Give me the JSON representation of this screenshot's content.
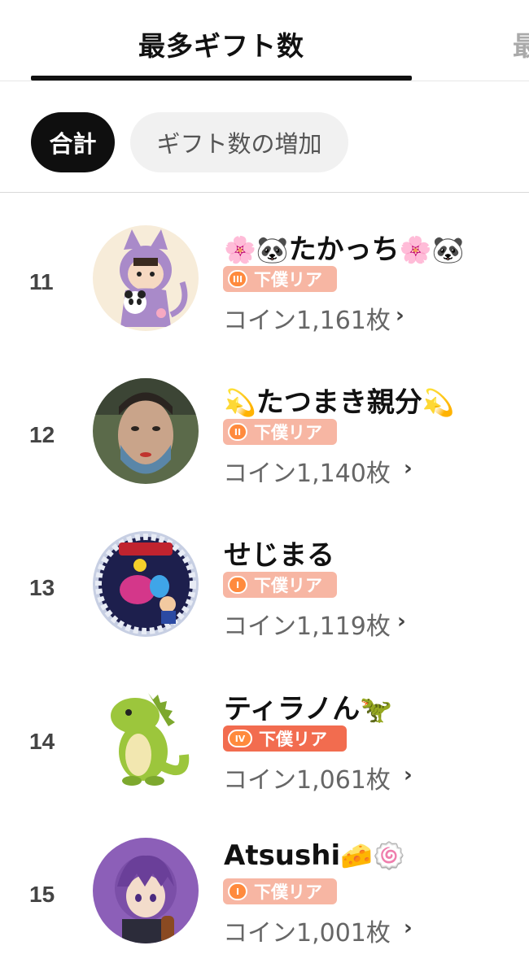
{
  "tabs": {
    "active": "最多ギフト数",
    "next_partial": "最"
  },
  "filters": {
    "total": "合計",
    "increase": "ギフト数の増加"
  },
  "badge_label": "下僕リア",
  "rows": [
    {
      "rank": "11",
      "name": "たかっち",
      "name_pre": "🌸🐼",
      "name_post": "🌸🐼",
      "badge_level": "III",
      "coins": "コイン1,161枚",
      "avatar": "cat-costume-panda-icon"
    },
    {
      "rank": "12",
      "name": "たつまき親分",
      "name_pre": "💫",
      "name_post": "💫",
      "badge_level": "II",
      "coins": "コイン1,140枚",
      "avatar": "face-photo-icon"
    },
    {
      "rank": "13",
      "name": "せじまる",
      "name_pre": "",
      "name_post": "",
      "badge_level": "I",
      "coins": "コイン1,119枚",
      "avatar": "momotaro-dentetsu-icon"
    },
    {
      "rank": "14",
      "name": "ティラノん",
      "name_pre": "",
      "name_post": "🦖",
      "badge_level": "IV",
      "coins": "コイン1,061枚",
      "avatar": "green-dinosaur-icon"
    },
    {
      "rank": "15",
      "name": "Atsushi",
      "name_pre": "",
      "name_post": "🧀🍥",
      "badge_level": "I",
      "coins": "コイン1,001枚",
      "avatar": "purple-hair-anime-icon"
    }
  ],
  "colors": {
    "badge_light": "#f7b6a3",
    "badge_strong": "#f26c4f",
    "active_chip": "#0f0f0f"
  }
}
